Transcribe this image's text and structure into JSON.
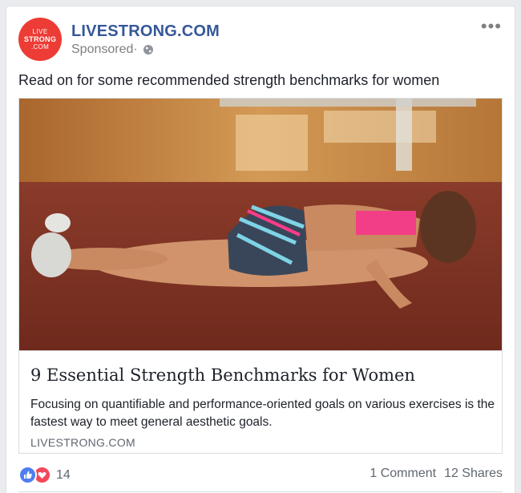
{
  "post": {
    "page_name": "LIVESTRONG.COM",
    "avatar": {
      "line1": "LIVE",
      "line2": "STRONG",
      "line3": ".COM",
      "color": "#ec3c35"
    },
    "sponsored": "Sponsored",
    "separator": " · ",
    "privacy_icon": "globe-icon",
    "menu_icon": "more-options-icon",
    "text": "Read on for some recommended strength benchmarks for women"
  },
  "link": {
    "title": "9 Essential Strength Benchmarks for Women",
    "description": "Focusing on quantifiable and performance-oriented goals on various exercises is the fastest way to meet general aesthetic goals.",
    "domain": "LIVESTRONG.COM"
  },
  "footer": {
    "reaction_count": "14",
    "reaction_icons": [
      "like-icon",
      "love-icon"
    ],
    "comments": "1 Comment",
    "shares": "12 Shares"
  },
  "colors": {
    "brand": "#365899",
    "love": "#f2485a",
    "like": "#4f7ef0"
  }
}
